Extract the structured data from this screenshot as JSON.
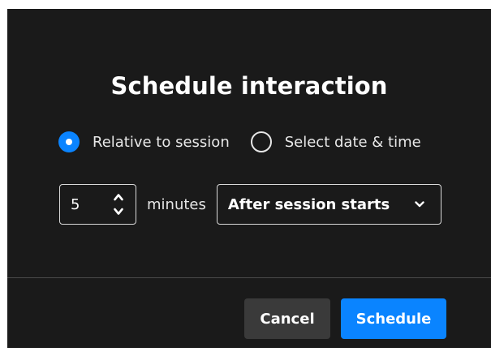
{
  "dialog": {
    "title": "Schedule interaction"
  },
  "timing_mode": {
    "options": [
      {
        "label": "Relative to session",
        "checked": true
      },
      {
        "label": "Select date & time",
        "checked": false
      }
    ]
  },
  "offset": {
    "value": "5",
    "unit_label": "minutes",
    "relation": {
      "selected": "After session starts"
    }
  },
  "footer": {
    "cancel_label": "Cancel",
    "primary_label": "Schedule"
  },
  "colors": {
    "dialog_background": "#1a1a1a",
    "accent": "#0a84ff",
    "secondary_button": "#3a3a3a"
  },
  "icons": {
    "stepper": "up-down-chevrons-icon",
    "select": "chevron-down-icon"
  }
}
